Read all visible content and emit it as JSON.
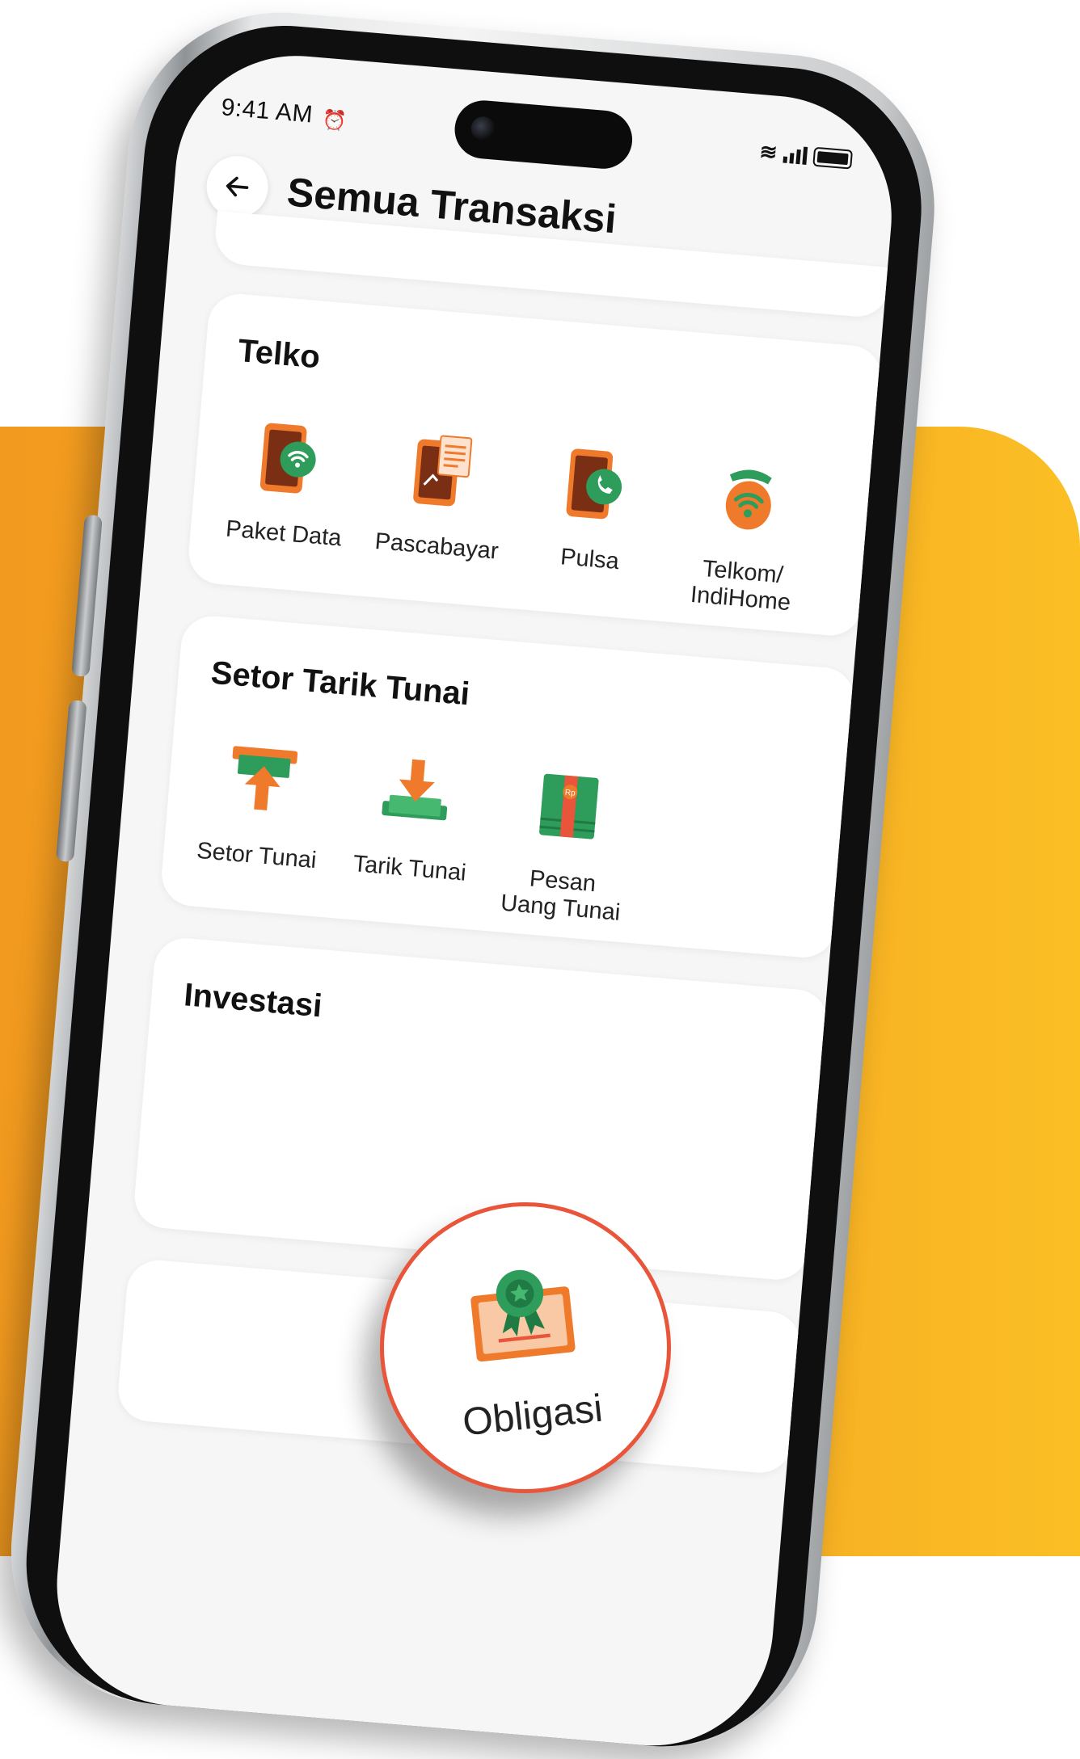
{
  "status_bar": {
    "time": "9:41 AM"
  },
  "header": {
    "title": "Semua Transaksi"
  },
  "sections": [
    {
      "title": "Telko",
      "items": [
        {
          "label": "Paket Data",
          "icon": "phone-wifi-icon"
        },
        {
          "label": "Pascabayar",
          "icon": "phone-bill-icon"
        },
        {
          "label": "Pulsa",
          "icon": "phone-call-icon"
        },
        {
          "label": "Telkom/\nIndiHome",
          "icon": "telephone-wifi-icon"
        }
      ]
    },
    {
      "title": "Setor Tarik Tunai",
      "items": [
        {
          "label": "Setor Tunai",
          "icon": "cash-deposit-icon"
        },
        {
          "label": "Tarik Tunai",
          "icon": "cash-withdraw-icon"
        },
        {
          "label": "Pesan\nUang Tunai",
          "icon": "cash-order-icon"
        }
      ]
    },
    {
      "title": "Investasi",
      "items": [
        {
          "label": "Obligasi",
          "icon": "bond-certificate-icon"
        }
      ]
    }
  ],
  "colors": {
    "accent_orange": "#e8553b",
    "icon_green": "#2e9c5a",
    "icon_orange": "#f07a2b",
    "background_orange": "#f5a623"
  }
}
